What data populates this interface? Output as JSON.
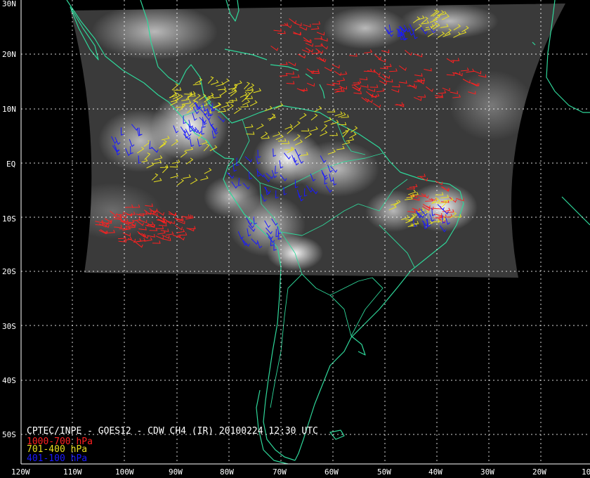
{
  "title": "CPTEC/INPE - GOES12 - CDW CH4 (IR) 20100224 12:30 UTC",
  "legend": [
    {
      "label": "1000-700 hPa",
      "color": "#ff2020"
    },
    {
      "label": "701-400 hPa",
      "color": "#e8e020"
    },
    {
      "label": "401-100 hPa",
      "color": "#1a1aff"
    }
  ],
  "axes": {
    "lon_ticks": [
      "120W",
      "110W",
      "100W",
      "90W",
      "80W",
      "70W",
      "60W",
      "50W",
      "40W",
      "30W",
      "20W",
      "10"
    ],
    "lat_ticks": [
      "30N",
      "20N",
      "10N",
      "EQ",
      "10S",
      "20S",
      "30S",
      "40S",
      "50S"
    ]
  },
  "colors": {
    "background": "#000000",
    "coastline": "#2fd79a",
    "grid": "#ffffff"
  },
  "imagery": "satellite infrared cloud imagery with wind vector barbs"
}
